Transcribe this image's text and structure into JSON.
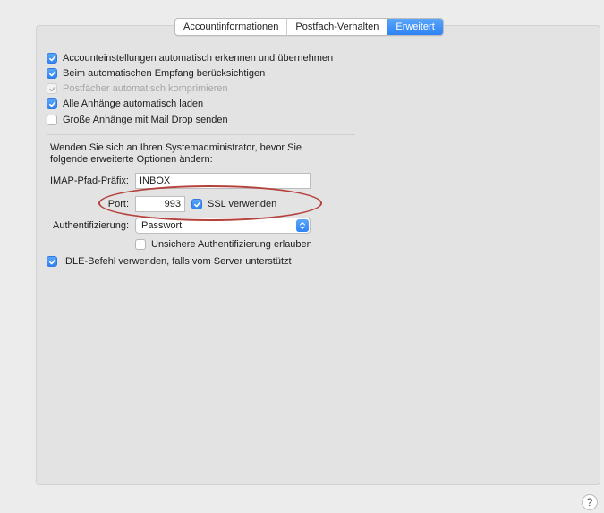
{
  "tabs": [
    {
      "label": "Accountinformationen",
      "active": false
    },
    {
      "label": "Postfach-Verhalten",
      "active": false
    },
    {
      "label": "Erweitert",
      "active": true
    }
  ],
  "options": [
    {
      "label": "Accounteinstellungen automatisch erkennen und übernehmen",
      "checked": true,
      "enabled": true
    },
    {
      "label": "Beim automatischen Empfang berücksichtigen",
      "checked": true,
      "enabled": true
    },
    {
      "label": "Postfächer automatisch komprimieren",
      "checked": true,
      "enabled": false
    },
    {
      "label": "Alle Anhänge automatisch laden",
      "checked": true,
      "enabled": true
    },
    {
      "label": "Große Anhänge mit Mail Drop senden",
      "checked": false,
      "enabled": true
    }
  ],
  "admin_note": "Wenden Sie sich an Ihren Systemadministrator, bevor Sie folgende erweiterte Optionen ändern:",
  "imap": {
    "label": "IMAP-Pfad-Präfix:",
    "value": "INBOX"
  },
  "port": {
    "label": "Port:",
    "value": "993"
  },
  "ssl": {
    "label": "SSL verwenden",
    "checked": true
  },
  "auth": {
    "label": "Authentifizierung:",
    "value": "Passwort"
  },
  "insecure_auth": {
    "label": "Unsichere Authentifizierung erlauben",
    "checked": false
  },
  "idle": {
    "label": "IDLE-Befehl verwenden, falls vom Server unterstützt",
    "checked": true
  },
  "help": {
    "label": "?"
  },
  "colors": {
    "accent": "#2f83f5",
    "highlight_oval": "#b5413c"
  }
}
